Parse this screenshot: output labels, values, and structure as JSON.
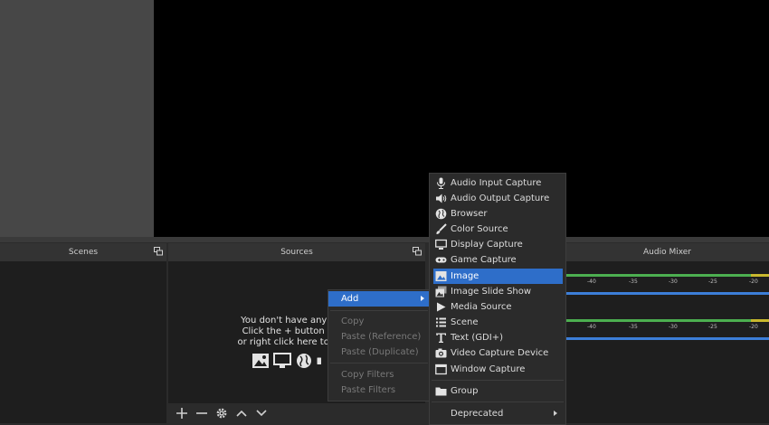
{
  "docks": {
    "scenes_title": "Scenes",
    "sources_title": "Sources",
    "audio_title": "Audio Mixer"
  },
  "sources_empty": {
    "line1": "You don't have any so",
    "line2": "Click the + button be",
    "line3": "or right click here to ad"
  },
  "context_menu": {
    "add": "Add",
    "copy": "Copy",
    "paste_reference": "Paste (Reference)",
    "paste_duplicate": "Paste (Duplicate)",
    "copy_filters": "Copy Filters",
    "paste_filters": "Paste Filters"
  },
  "add_menu": [
    {
      "label": "Audio Input Capture",
      "icon": "microphone-icon"
    },
    {
      "label": "Audio Output Capture",
      "icon": "speaker-icon"
    },
    {
      "label": "Browser",
      "icon": "globe-icon"
    },
    {
      "label": "Color Source",
      "icon": "paintbrush-icon"
    },
    {
      "label": "Display Capture",
      "icon": "monitor-icon"
    },
    {
      "label": "Game Capture",
      "icon": "gamepad-icon"
    },
    {
      "label": "Image",
      "icon": "image-icon",
      "highlighted": true
    },
    {
      "label": "Image Slide Show",
      "icon": "slideshow-icon"
    },
    {
      "label": "Media Source",
      "icon": "play-icon"
    },
    {
      "label": "Scene",
      "icon": "list-icon"
    },
    {
      "label": "Text (GDI+)",
      "icon": "text-icon"
    },
    {
      "label": "Video Capture Device",
      "icon": "camera-icon"
    },
    {
      "label": "Window Capture",
      "icon": "window-icon"
    },
    {
      "label": "Group",
      "icon": "folder-icon"
    },
    {
      "label": "Deprecated",
      "icon": "",
      "submenu": true
    }
  ],
  "audio_ticks": [
    "-40",
    "-35",
    "-30",
    "-25",
    "-20"
  ],
  "colors": {
    "highlight": "#2e6ec9",
    "meter_green": "#4caf50",
    "meter_yellow": "#c9b82e",
    "meter_blue": "#3c7ed8"
  }
}
